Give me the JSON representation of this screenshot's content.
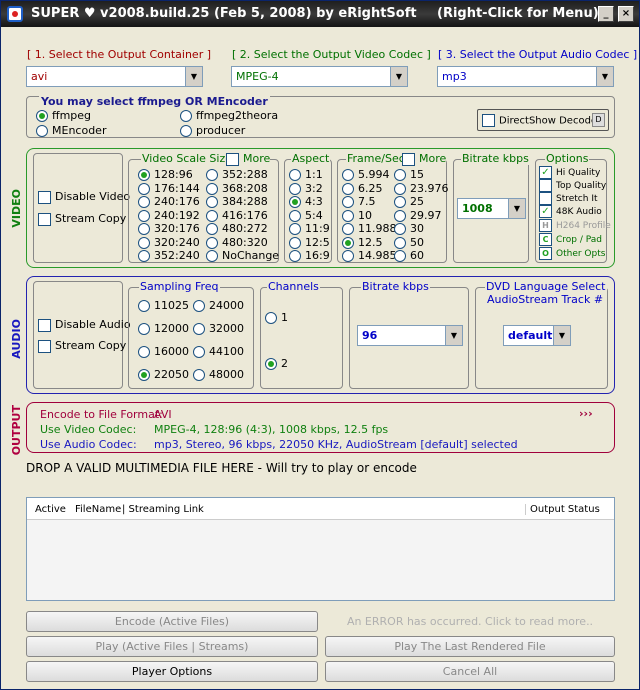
{
  "titlebar": {
    "title": "SUPER ♥ v2008.build.25 (Feb 5, 2008) by eRightSoft",
    "hint": "(Right-Click for Menu)",
    "minimize": "_",
    "close": "×"
  },
  "headers": {
    "container": "[ 1.     Select the Output Container ]",
    "video_codec": "[ 2.   Select the Output Video Codec ]",
    "audio_codec": "[ 3.   Select the Output Audio Codec ]"
  },
  "combos": {
    "container": "avi",
    "video_codec": "MPEG-4",
    "audio_codec": "mp3"
  },
  "encoder": {
    "title": "You may select ffmpeg OR MEncoder",
    "ffmpeg": "ffmpeg",
    "mencoder": "MEncoder",
    "ffmpeg2theora": "ffmpeg2theora",
    "producer": "producer",
    "directshow": "DirectShow Decode",
    "ds_btn": "D"
  },
  "video": {
    "side": "VIDEO",
    "disable": "Disable Video",
    "stream_copy": "Stream Copy",
    "scale_title": "Video Scale Size",
    "more": "More",
    "scale_col1": [
      "128:96",
      "176:144",
      "240:176",
      "240:192",
      "320:176",
      "320:240",
      "352:240"
    ],
    "scale_col2": [
      "352:288",
      "368:208",
      "384:288",
      "416:176",
      "480:272",
      "480:320",
      "NoChange"
    ],
    "aspect_title": "Aspect",
    "aspect": [
      "1:1",
      "3:2",
      "4:3",
      "5:4",
      "11:9",
      "12:5",
      "16:9"
    ],
    "fps_title": "Frame/Sec",
    "fps_more": "More",
    "fps_col1": [
      "5.994",
      "6.25",
      "7.5",
      "10",
      "11.988",
      "12.5",
      "14.985"
    ],
    "fps_col2": [
      "15",
      "23.976",
      "25",
      "29.97",
      "30",
      "50",
      "60"
    ],
    "bitrate_title": "Bitrate  kbps",
    "bitrate": "1008",
    "options_title": "Options",
    "opt_hq": "Hi Quality",
    "opt_top": "Top Quality",
    "opt_stretch": "Stretch It",
    "opt_48k": "48K Audio",
    "opt_h264": "H264 Profile",
    "opt_crop": "Crop / Pad",
    "opt_other": "Other Opts",
    "opt_h": "H",
    "opt_c": "C",
    "opt_o": "O"
  },
  "audio": {
    "side": "AUDIO",
    "disable": "Disable Audio",
    "stream_copy": "Stream Copy",
    "freq_title": "Sampling Freq",
    "freq_col1": [
      "11025",
      "12000",
      "16000",
      "22050"
    ],
    "freq_col2": [
      "24000",
      "32000",
      "44100",
      "48000"
    ],
    "channels_title": "Channels",
    "ch1": "1",
    "ch2": "2",
    "bitrate_title": "Bitrate  kbps",
    "bitrate": "96",
    "dvd_title": "DVD Language Select",
    "dvd_sub": "AudioStream  Track #",
    "dvd_value": "default"
  },
  "output": {
    "side": "OUTPUT",
    "format_label": "Encode to File Format:",
    "format_value": "AVI",
    "arrows": "›››",
    "video_label": "Use Video Codec:",
    "video_value": "MPEG-4,   128:96 (4:3),   1008 kbps,   12.5 fps",
    "audio_label": "Use Audio Codec:",
    "audio_value": "mp3,   Stereo,   96 kbps,   22050 KHz,   AudioStream [default] selected"
  },
  "drop_text": "DROP A VALID MULTIMEDIA FILE HERE - Will try to play or encode",
  "table": {
    "cols": [
      "Active",
      "FileName",
      "|   Streaming Link",
      "Output Status"
    ]
  },
  "buttons": {
    "encode": "Encode (Active Files)",
    "error": "An ERROR has occurred. Click to read more..",
    "play": "Play (Active Files | Streams)",
    "play_last": "Play The Last Rendered File",
    "player_options": "Player Options",
    "cancel": "Cancel All"
  }
}
